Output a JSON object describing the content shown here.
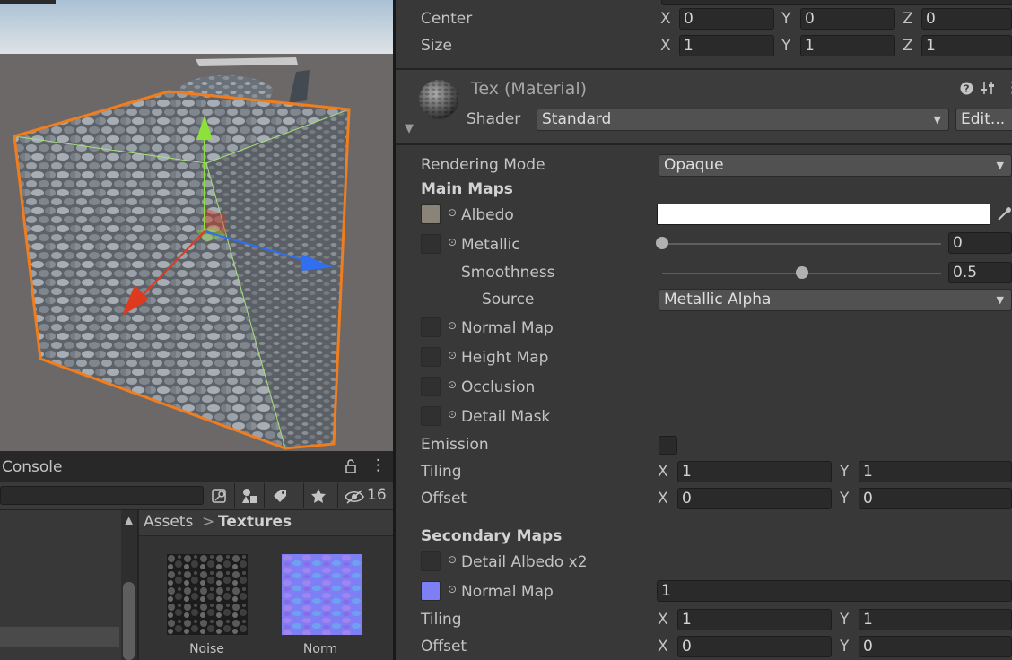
{
  "transform": {
    "center": {
      "label": "Center",
      "x": "0",
      "y": "0",
      "z": "0"
    },
    "size": {
      "label": "Size",
      "x": "1",
      "y": "1",
      "z": "1"
    }
  },
  "axis": {
    "x": "X",
    "y": "Y",
    "z": "Z"
  },
  "material": {
    "title": "Tex (Material)",
    "shader_label": "Shader",
    "shader_value": "Standard",
    "edit_label": "Edit...",
    "rendering_mode_label": "Rendering Mode",
    "rendering_mode_value": "Opaque",
    "main_maps": "Main Maps",
    "albedo": "Albedo",
    "albedo_color": "#ffffff",
    "metallic": "Metallic",
    "metallic_value": "0",
    "metallic_level": 0,
    "smoothness": "Smoothness",
    "smoothness_value": "0.5",
    "smoothness_level": 0.5,
    "source": "Source",
    "source_value": "Metallic Alpha",
    "normal_map": "Normal Map",
    "height_map": "Height Map",
    "occlusion": "Occlusion",
    "detail_mask": "Detail Mask",
    "emission": "Emission",
    "tiling": "Tiling",
    "offset": "Offset",
    "main_tiling": {
      "x": "1",
      "y": "1"
    },
    "main_offset": {
      "x": "0",
      "y": "0"
    },
    "secondary_maps": "Secondary Maps",
    "detail_albedo": "Detail Albedo x2",
    "detail_normal_map": "Normal Map",
    "detail_normal_value": "1",
    "sec_tiling": {
      "x": "1",
      "y": "1"
    },
    "sec_offset": {
      "x": "0",
      "y": "0"
    }
  },
  "console": {
    "title": "Console",
    "hidden_count": "16",
    "breadcrumb_root": "Assets",
    "breadcrumb_sep": ">",
    "breadcrumb_current": "Textures",
    "assets": [
      {
        "name": "Noise"
      },
      {
        "name": "Norm"
      }
    ]
  },
  "colors": {
    "accent_orange": "#f07d1e",
    "gizmo_x": "#e03a1e",
    "gizmo_y": "#8ee03a",
    "gizmo_z": "#2f6ff0"
  }
}
